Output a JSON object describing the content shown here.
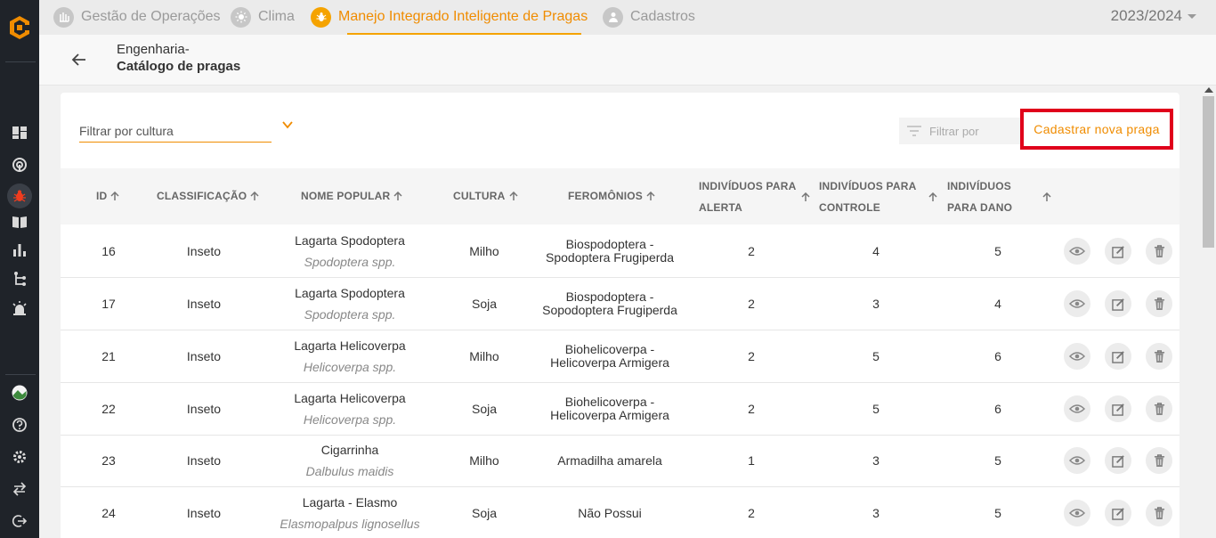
{
  "topbar": {
    "tabs": [
      {
        "label": "Gestão de Operações",
        "icon": "operations-icon"
      },
      {
        "label": "Clima",
        "icon": "sun-icon"
      },
      {
        "label": "Manejo Integrado Inteligente de Pragas",
        "icon": "bug-icon",
        "active": true
      },
      {
        "label": "Cadastros",
        "icon": "person-icon"
      }
    ],
    "season": "2023/2024"
  },
  "header": {
    "breadcrumb_parent": "Engenharia-",
    "title": "Catálogo de pragas"
  },
  "filters": {
    "culture_placeholder": "Filtrar por cultura",
    "filter_by_placeholder": "Filtrar por"
  },
  "new_button": "Cadastrar nova praga",
  "table": {
    "columns": {
      "id": "ID",
      "classification": "CLASSIFICAÇÃO",
      "popular_name": "NOME POPULAR",
      "culture": "CULTURA",
      "pheromones": "FEROMÔNIOS",
      "alert_l1": "INDIVÍDUOS PARA",
      "alert_l2": "ALERTA",
      "control_l1": "INDIVÍDUOS PARA",
      "control_l2": "CONTROLE",
      "damage_l1": "INDIVÍDUOS",
      "damage_l2": "PARA DANO"
    },
    "rows": [
      {
        "id": "16",
        "classification": "Inseto",
        "popular": "Lagarta Spodoptera",
        "scientific": "Spodoptera spp.",
        "culture": "Milho",
        "pheromone_l1": "Biospodoptera -",
        "pheromone_l2": "Spodoptera Frugiperda",
        "alert": "2",
        "control": "4",
        "damage": "5"
      },
      {
        "id": "17",
        "classification": "Inseto",
        "popular": "Lagarta Spodoptera",
        "scientific": "Spodoptera spp.",
        "culture": "Soja",
        "pheromone_l1": "Biospodoptera -",
        "pheromone_l2": "Sopodoptera Frugiperda",
        "alert": "2",
        "control": "3",
        "damage": "4"
      },
      {
        "id": "21",
        "classification": "Inseto",
        "popular": "Lagarta Helicoverpa",
        "scientific": "Helicoverpa spp.",
        "culture": "Milho",
        "pheromone_l1": "Biohelicoverpa -",
        "pheromone_l2": "Helicoverpa Armigera",
        "alert": "2",
        "control": "5",
        "damage": "6"
      },
      {
        "id": "22",
        "classification": "Inseto",
        "popular": "Lagarta Helicoverpa",
        "scientific": "Helicoverpa spp.",
        "culture": "Soja",
        "pheromone_l1": "Biohelicoverpa -",
        "pheromone_l2": "Helicoverpa Armigera",
        "alert": "2",
        "control": "5",
        "damage": "6"
      },
      {
        "id": "23",
        "classification": "Inseto",
        "popular": "Cigarrinha",
        "scientific": "Dalbulus maidis",
        "culture": "Milho",
        "pheromone_l1": "Armadilha amarela",
        "pheromone_l2": "",
        "alert": "1",
        "control": "3",
        "damage": "5"
      },
      {
        "id": "24",
        "classification": "Inseto",
        "popular": "Lagarta - Elasmo",
        "scientific": "Elasmopalpus lignosellus",
        "culture": "Soja",
        "pheromone_l1": "Não Possui",
        "pheromone_l2": "",
        "alert": "2",
        "control": "3",
        "damage": "5"
      }
    ]
  },
  "colors": {
    "accent": "#f08c00",
    "highlight_border": "#e0001b",
    "sidebar": "#1f2329"
  }
}
